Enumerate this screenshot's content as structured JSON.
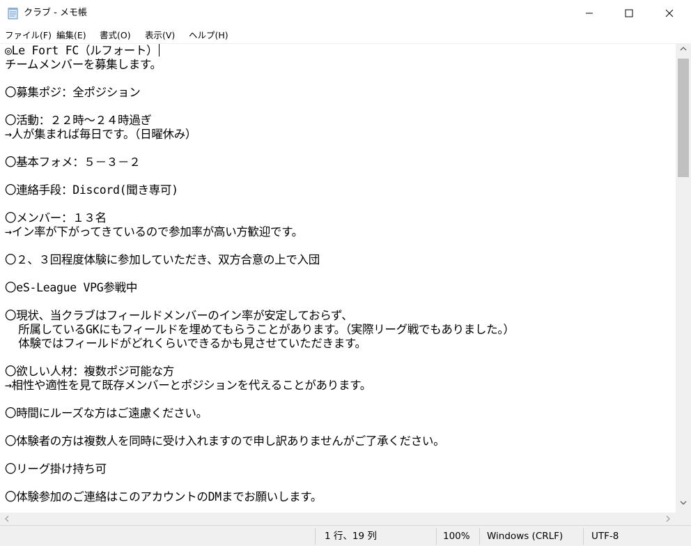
{
  "window": {
    "title": "クラブ - メモ帳"
  },
  "menu": {
    "items": [
      "ファイル(F)",
      "編集(E)",
      "書式(O)",
      "表示(V)",
      "ヘルプ(H)"
    ]
  },
  "editor": {
    "lines": [
      "◎Le Fort FC（ルフォート）",
      "チームメンバーを募集します。",
      "",
      "〇募集ポジ：全ポジション",
      "",
      "〇活動：２２時～２４時過ぎ",
      "→人が集まれば毎日です。（日曜休み）",
      "",
      "〇基本フォメ：５－３－２",
      "",
      "〇連絡手段：Discord(聞き専可)",
      "",
      "〇メンバー：１３名",
      "→イン率が下がってきているので参加率が高い方歓迎です。",
      "",
      "〇２、３回程度体験に参加していただき、双方合意の上で入団",
      "",
      "〇eS-League VPG参戦中",
      "",
      "〇現状、当クラブはフィールドメンバーのイン率が安定しておらず、",
      "  所属しているGKにもフィールドを埋めてもらうことがあります。（実際リーグ戦でもありました。）",
      "  体験ではフィールドがどれくらいできるかも見させていただきます。",
      "",
      "〇欲しい人材：複数ポジ可能な方",
      "→相性や適性を見て既存メンバーとポジションを代えることがあります。",
      "",
      "〇時間にルーズな方はご遠慮ください。",
      "",
      "〇体験者の方は複数人を同時に受け入れますので申し訳ありませんがご了承ください。",
      "",
      "〇リーグ掛け持ち可",
      "",
      "〇体験参加のご連絡はこのアカウントのDMまでお願いします。"
    ]
  },
  "status": {
    "position": "1 行、19 列",
    "zoom": "100%",
    "line_ending": "Windows (CRLF)",
    "encoding": "UTF-8"
  },
  "icons": {
    "app": "notepad-icon",
    "minimize": "minimize-icon",
    "maximize": "maximize-icon",
    "close": "close-icon"
  }
}
